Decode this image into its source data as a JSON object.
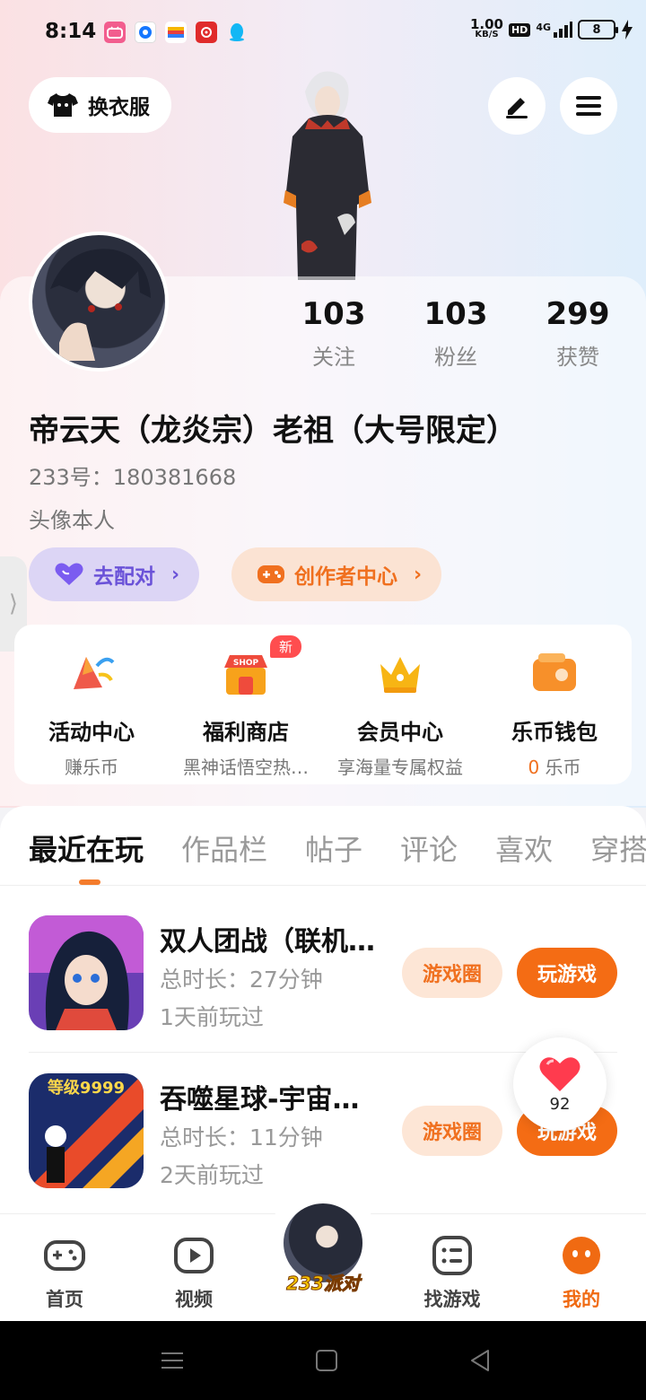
{
  "status_bar": {
    "time": "8:14",
    "net_speed_value": "1.00",
    "net_speed_unit": "KB/S",
    "hd": "HD",
    "network": "4G",
    "battery": "8"
  },
  "header": {
    "outfit_label": "换衣服"
  },
  "profile": {
    "stats": [
      {
        "value": "103",
        "label": "关注"
      },
      {
        "value": "103",
        "label": "粉丝"
      },
      {
        "value": "299",
        "label": "获赞"
      }
    ],
    "username": "帝云天（龙炎宗）老祖（大号限定）",
    "uid": "233号：180381668",
    "bio": "头像本人",
    "match_label": "去配对",
    "creator_label": "创作者中心"
  },
  "features": [
    {
      "title": "活动中心",
      "sub": "赚乐币",
      "icon": "activity-icon"
    },
    {
      "title": "福利商店",
      "sub": "黑神话悟空热…",
      "icon": "shop-icon",
      "badge": "新",
      "icon_text": "SHOP"
    },
    {
      "title": "会员中心",
      "sub": "享海量专属权益",
      "icon": "crown-icon"
    },
    {
      "title": "乐币钱包",
      "sub_num": "0",
      "sub_unit": "乐币",
      "icon": "wallet-icon"
    }
  ],
  "tabs": [
    "最近在玩",
    "作品栏",
    "帖子",
    "评论",
    "喜欢",
    "穿搭"
  ],
  "games": [
    {
      "title": "双人团战（联机…",
      "duration": "总时长：27分钟",
      "last_played": "1天前玩过",
      "circle_label": "游戏圈",
      "play_label": "玩游戏"
    },
    {
      "title": "吞噬星球-宇宙…",
      "duration": "总时长：11分钟",
      "last_played": "2天前玩过",
      "circle_label": "游戏圈",
      "play_label": "玩游戏",
      "thumb_text": "等级9999"
    }
  ],
  "like_float": {
    "count": "92"
  },
  "bottom_nav": {
    "home": "首页",
    "video": "视频",
    "center": "233派对",
    "find": "找游戏",
    "mine": "我的"
  },
  "colors": {
    "accent": "#f46c14",
    "match_purple": "#6a52d8"
  }
}
